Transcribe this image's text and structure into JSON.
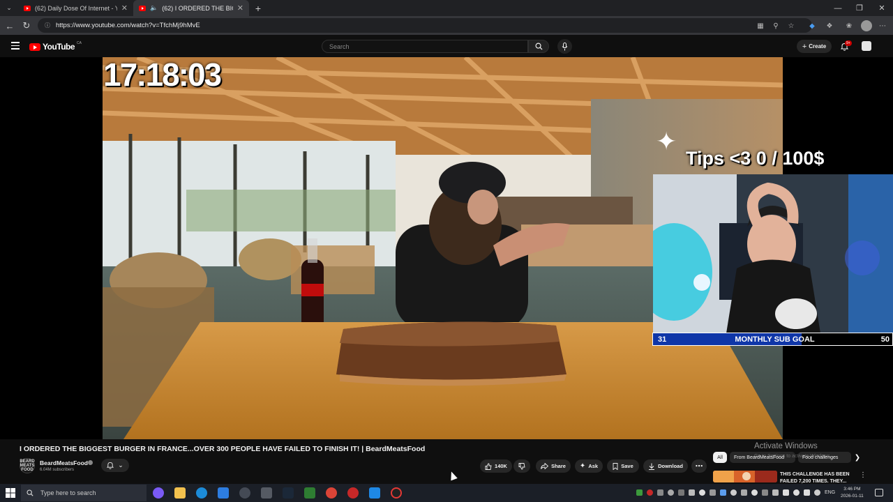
{
  "browser": {
    "tabs": [
      {
        "title": "(62) Daily Dose Of Internet - YouT",
        "active": false
      },
      {
        "title": "(62) I ORDERED THE BIGGEST",
        "active": true
      }
    ],
    "new_tab_icon": "plus-icon",
    "url": "https://www.youtube.com/watch?v=TfchMj9hMvE"
  },
  "youtube": {
    "logo_text": "YouTube",
    "region": "CA",
    "search_placeholder": "Search",
    "create_label": "Create",
    "notification_badge": "9+"
  },
  "video": {
    "timer_overlay": "17:18:03",
    "tips_overlay": "Tips <3   0 / 100$",
    "sub_goal": {
      "current": "31",
      "label": "MONTHLY SUB GOAL",
      "target": "50",
      "progress": 0.62
    },
    "title": "I ORDERED THE BIGGEST BURGER IN FRANCE...OVER 300 PEOPLE HAVE FAILED TO FINISH IT! | BeardMeatsFood"
  },
  "channel": {
    "avatar_text": "BEARD MEATS FOOD",
    "name": "BeardMeatsFood",
    "subscribers": "6.04M subscribers"
  },
  "actions": {
    "likes": "140K",
    "share": "Share",
    "ask": "Ask",
    "save": "Save",
    "download": "Download"
  },
  "sidebar": {
    "chips": [
      "All",
      "From BeardMeatsFood",
      "Food challenges"
    ],
    "recommended_title": "THIS CHALLENGE HAS BEEN FAILED 7,200 TIMES. THEY..."
  },
  "watermark": {
    "title": "Activate Windows",
    "subtitle": "Go to Settings to activate Windows."
  },
  "taskbar": {
    "search_placeholder": "Type here to search",
    "language": "ENG",
    "time": "3:46 PM",
    "date": "2026-01-11"
  },
  "colors": {
    "youtube_red": "#ff0000",
    "sub_goal_fill": "#0f36a8",
    "background": "#0f0f0f"
  }
}
